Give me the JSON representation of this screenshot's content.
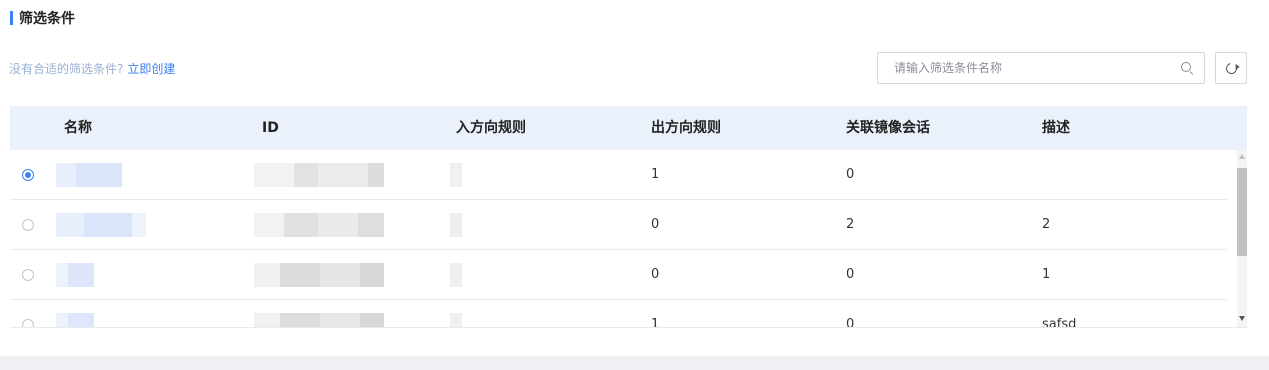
{
  "section": {
    "title": "筛选条件"
  },
  "hint": {
    "text": "没有合适的筛选条件?",
    "link": "立即创建"
  },
  "search": {
    "placeholder": "请输入筛选条件名称",
    "value": ""
  },
  "table": {
    "columns": [
      "名称",
      "ID",
      "入方向规则",
      "出方向规则",
      "关联镜像会话",
      "描述"
    ],
    "rows": [
      {
        "selected": true,
        "name": "",
        "id": "",
        "inbound": "",
        "outbound": "1",
        "sessions": "0",
        "desc": ""
      },
      {
        "selected": false,
        "name": "",
        "id": "",
        "inbound": "",
        "outbound": "0",
        "sessions": "2",
        "desc": "2"
      },
      {
        "selected": false,
        "name": "",
        "id": "",
        "inbound": "",
        "outbound": "0",
        "sessions": "0",
        "desc": "1"
      },
      {
        "selected": false,
        "name": "",
        "id": "",
        "inbound": "",
        "outbound": "1",
        "sessions": "0",
        "desc": "safsd"
      }
    ]
  },
  "colors": {
    "accent": "#3d7ff5",
    "header_bg": "#ebf1fb"
  },
  "icons": {
    "search": "search-icon",
    "refresh": "refresh-icon"
  }
}
